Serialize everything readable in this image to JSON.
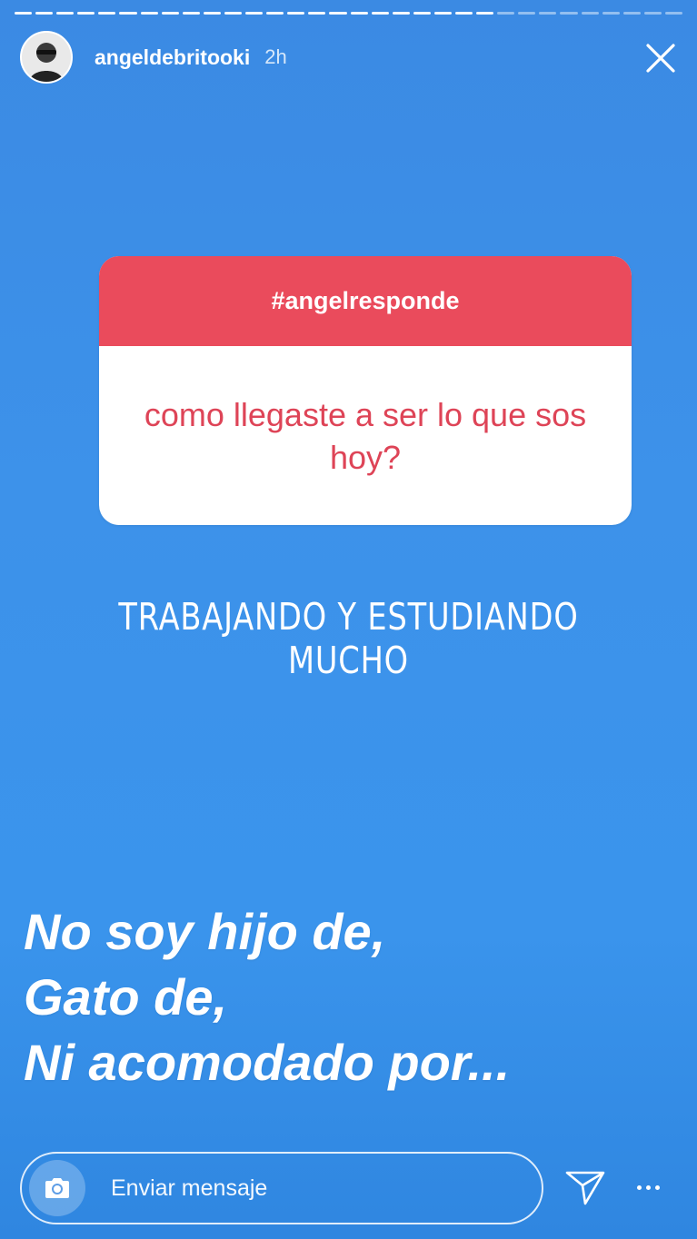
{
  "story": {
    "progress": {
      "segments": 32,
      "completed": 23
    },
    "header": {
      "username": "angeldebritooki",
      "time_ago": "2h"
    },
    "question": {
      "tag": "#angelresponde",
      "text": "como llegaste a ser lo que sos hoy?"
    },
    "answer": "TRABAJANDO Y ESTUDIANDO MUCHO",
    "statement": [
      "No soy hijo de,",
      "Gato de,",
      "Ni acomodado por..."
    ],
    "reply": {
      "placeholder": "Enviar mensaje"
    },
    "colors": {
      "background": "#3b8ae3",
      "question_header": "#ea4b5c",
      "question_text": "#de4457"
    }
  },
  "icons": [
    "close-icon",
    "camera-icon",
    "send-icon",
    "more-options-icon",
    "avatar"
  ]
}
